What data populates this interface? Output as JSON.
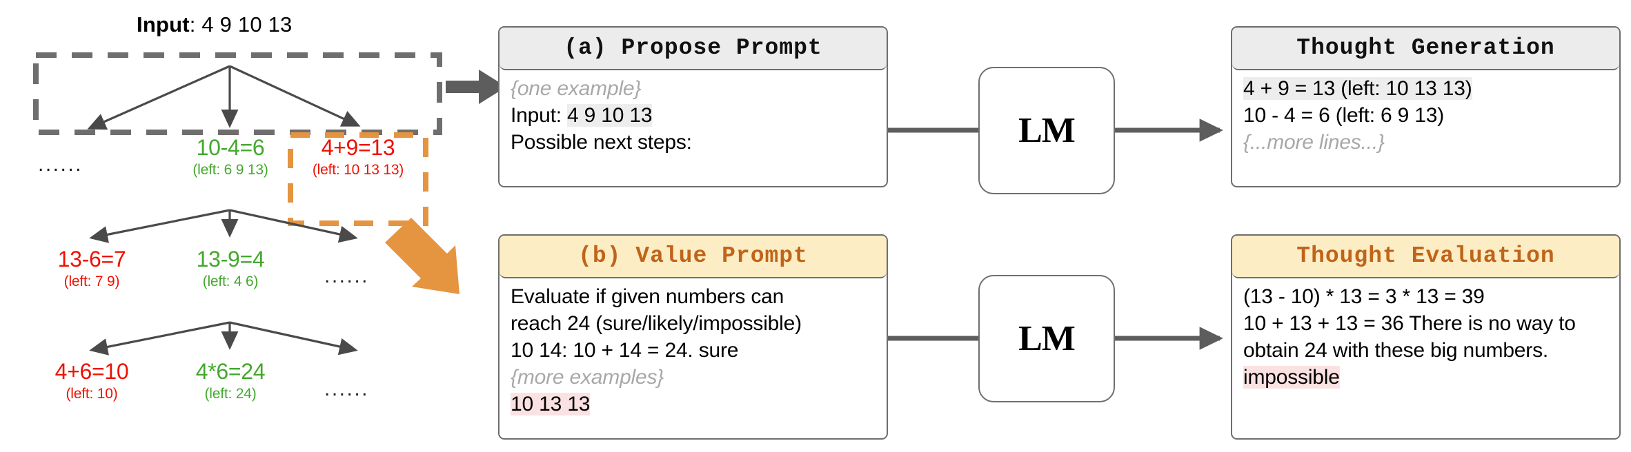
{
  "tree": {
    "input_label": "Input",
    "input_value": "4 9 10 13",
    "ellipsis": "......",
    "nodes": [
      {
        "id": "n-10-4",
        "expr": "10-4=6",
        "left": "(left: 6 9 13)",
        "color": "green"
      },
      {
        "id": "n-4-9",
        "expr": "4+9=13",
        "left": "(left: 10 13 13)",
        "color": "red"
      },
      {
        "id": "n-13-6",
        "expr": "13-6=7",
        "left": "(left: 7 9)",
        "color": "red"
      },
      {
        "id": "n-13-9",
        "expr": "13-9=4",
        "left": "(left: 4 6)",
        "color": "green"
      },
      {
        "id": "n-4p6",
        "expr": "4+6=10",
        "left": "(left: 10)",
        "color": "red"
      },
      {
        "id": "n-4x6",
        "expr": "4*6=24",
        "left": "(left: 24)",
        "color": "green"
      }
    ]
  },
  "panels": {
    "propose_prompt": {
      "title": "(a) Propose Prompt",
      "lines": {
        "example": "{one example}",
        "input_prefix": "Input: ",
        "input_value": "4 9 10 13",
        "possible": "Possible next steps:"
      }
    },
    "value_prompt": {
      "title": "(b) Value Prompt",
      "lines": {
        "l1": "Evaluate if given numbers can",
        "l2": "reach 24 (sure/likely/impossible)",
        "l3": "10 14: 10 + 14 = 24. sure",
        "l4": "{more examples}",
        "l5": "10 13 13"
      }
    },
    "thought_generation": {
      "title": "Thought Generation",
      "lines": {
        "l1": "4 + 9 = 13 (left: 10 13 13)",
        "l2": "10 - 4 = 6 (left: 6 9 13)",
        "l3": "{...more lines...}"
      }
    },
    "thought_evaluation": {
      "title": "Thought Evaluation",
      "lines": {
        "l1": "(13 - 10) * 13 = 3 * 13 = 39",
        "l2a": "10 + 13 + 13 = 36 There is no way to obtain 24 with these big numbers. ",
        "l2b": "impossible"
      }
    }
  },
  "model_boxes": {
    "top_label": "LM",
    "bottom_label": "LM"
  },
  "colors": {
    "green": "#43a82d",
    "red": "#f01000",
    "orange": "#e59440",
    "gray_arrow": "#5d5d5d",
    "head_gray": "#ececec",
    "head_amber": "#fcedc4",
    "amber_text": "#c0641a",
    "highlight_gray": "#ededed",
    "highlight_pink": "#fbe2e2"
  }
}
